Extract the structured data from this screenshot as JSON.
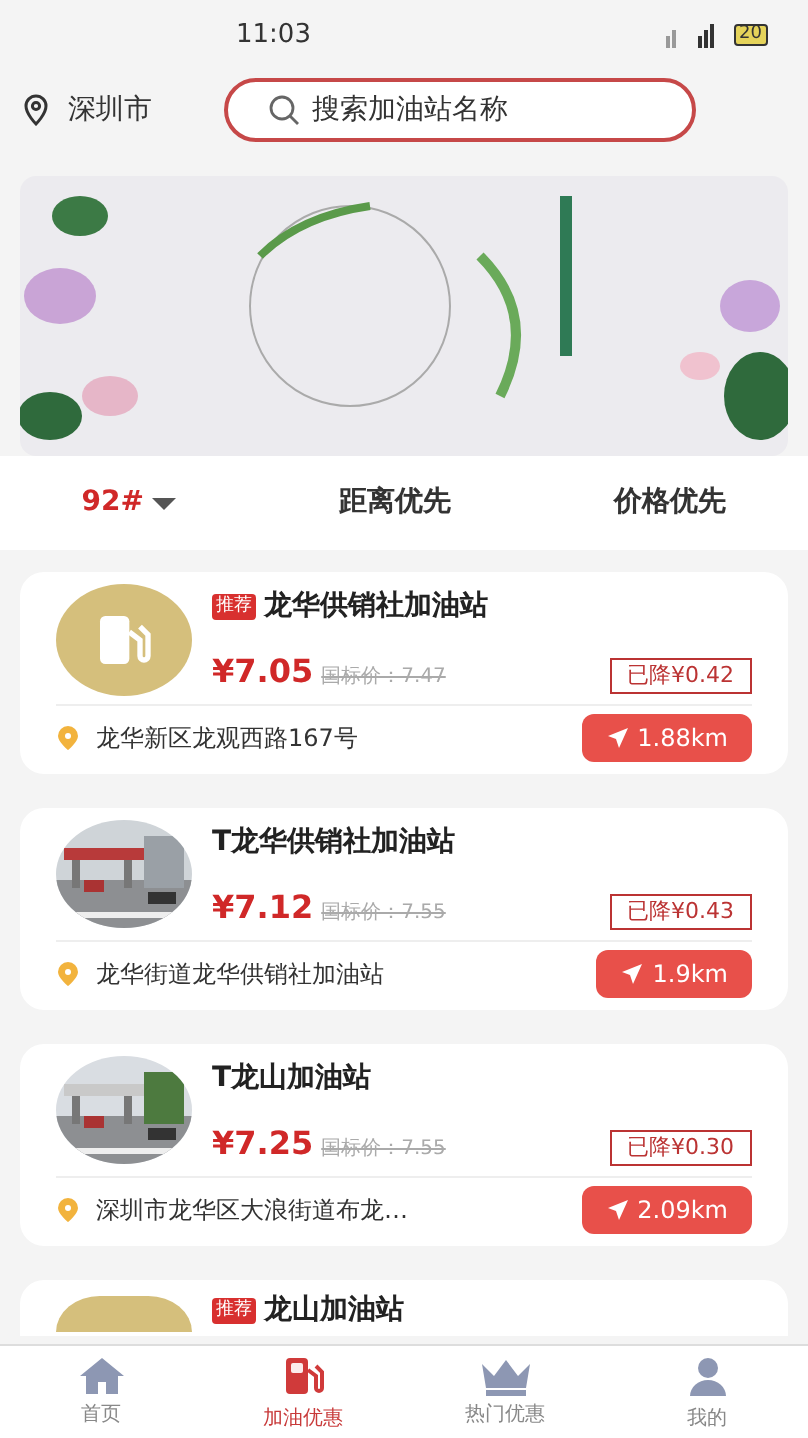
{
  "status_bar": {
    "time": "11:03",
    "battery": "20"
  },
  "header": {
    "city": "深圳市",
    "search": {
      "placeholder": "搜索加油站名称"
    }
  },
  "sort_tabs": [
    {
      "label": "92#",
      "selected": true,
      "kind": "dropdown"
    },
    {
      "label": "距离优先",
      "selected": false,
      "kind": "plain"
    },
    {
      "label": "价格优先",
      "selected": false,
      "kind": "plain"
    }
  ],
  "stations": [
    {
      "kind": "logo",
      "tag": "推荐",
      "name": "龙华供销社加油站",
      "price": "¥7.05",
      "list_price": "国标价：7.47",
      "discount": "已降¥0.42",
      "address": "龙华新区龙观西路167号",
      "distance": "1.88km"
    },
    {
      "kind": "picture",
      "name": "T龙华供销社加油站",
      "price": "¥7.12",
      "list_price": "国标价：7.55",
      "discount": "已降¥0.43",
      "address": "龙华街道龙华供销社加油站",
      "distance": "1.9km"
    },
    {
      "kind": "picture",
      "name": "T龙山加油站",
      "price": "¥7.25",
      "list_price": "国标价：7.55",
      "discount": "已降¥0.30",
      "address": "深圳市龙华区大浪街道布龙…",
      "distance": "2.09km"
    },
    {
      "kind": "logo",
      "tag": "推荐",
      "name": "龙山加油站"
    }
  ],
  "bottom_nav": [
    {
      "label": "首页",
      "selected": false
    },
    {
      "label": "加油优惠",
      "selected": true
    },
    {
      "label": "热门优惠",
      "selected": false
    },
    {
      "label": "我的",
      "selected": false
    }
  ]
}
